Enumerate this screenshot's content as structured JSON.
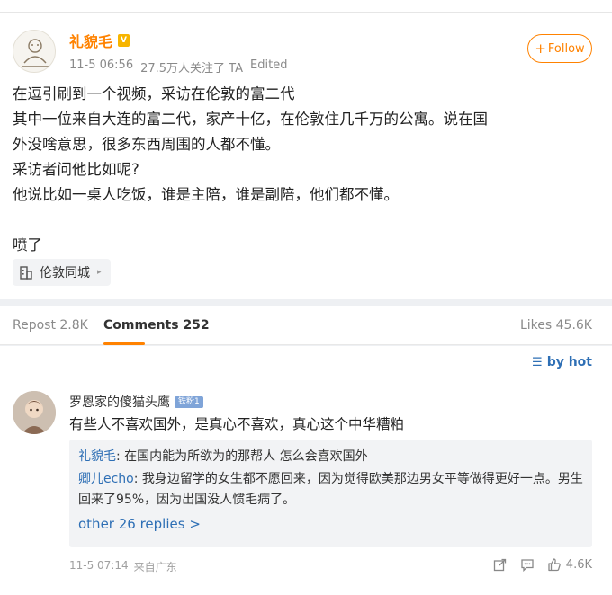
{
  "post": {
    "author": "礼貌毛",
    "timestamp": "11-5 06:56",
    "followers_note": "27.5万人关注了 TA",
    "edited": "Edited",
    "follow_label": "Follow",
    "follow_prefix": "+",
    "body_lines": [
      "在逗引刷到一个视频，采访在伦敦的富二代",
      "其中一位来自大连的富二代，家产十亿，在伦敦住几千万的公寓。说在国",
      "外没啥意思，很多东西周围的人都不懂。",
      "采访者问他比如呢?",
      "他说比如一桌人吃饭，谁是主陪，谁是副陪，他们都不懂。",
      "",
      "喷了"
    ],
    "location": "伦敦同城"
  },
  "tabs": {
    "repost": "Repost 2.8K",
    "comments_label": "Comments",
    "comments_count": "252",
    "likes": "Likes 45.6K"
  },
  "comments": {
    "sort_label": "by hot",
    "items": [
      {
        "user": "罗恩家的傻猫头鹰",
        "badge": "铁粉1",
        "text": "有些人不喜欢国外，是真心不喜欢，真心这个中华糟粕",
        "replies": [
          {
            "user": "礼貌毛",
            "text": ": 在国内能为所欲为的那帮人 怎么会喜欢国外"
          },
          {
            "user": "卿儿echo",
            "text": ": 我身边留学的女生都不愿回来，因为觉得欧美那边男女平等做得更好一点。男生回来了95%，因为出国没人惯毛病了。"
          }
        ],
        "more_replies": "other 26 replies >",
        "time": "11-5 07:14",
        "source": "来自广东",
        "likes": "4.6K"
      }
    ]
  },
  "colors": {
    "accent": "#ff8200",
    "link": "#2e6fb5"
  }
}
